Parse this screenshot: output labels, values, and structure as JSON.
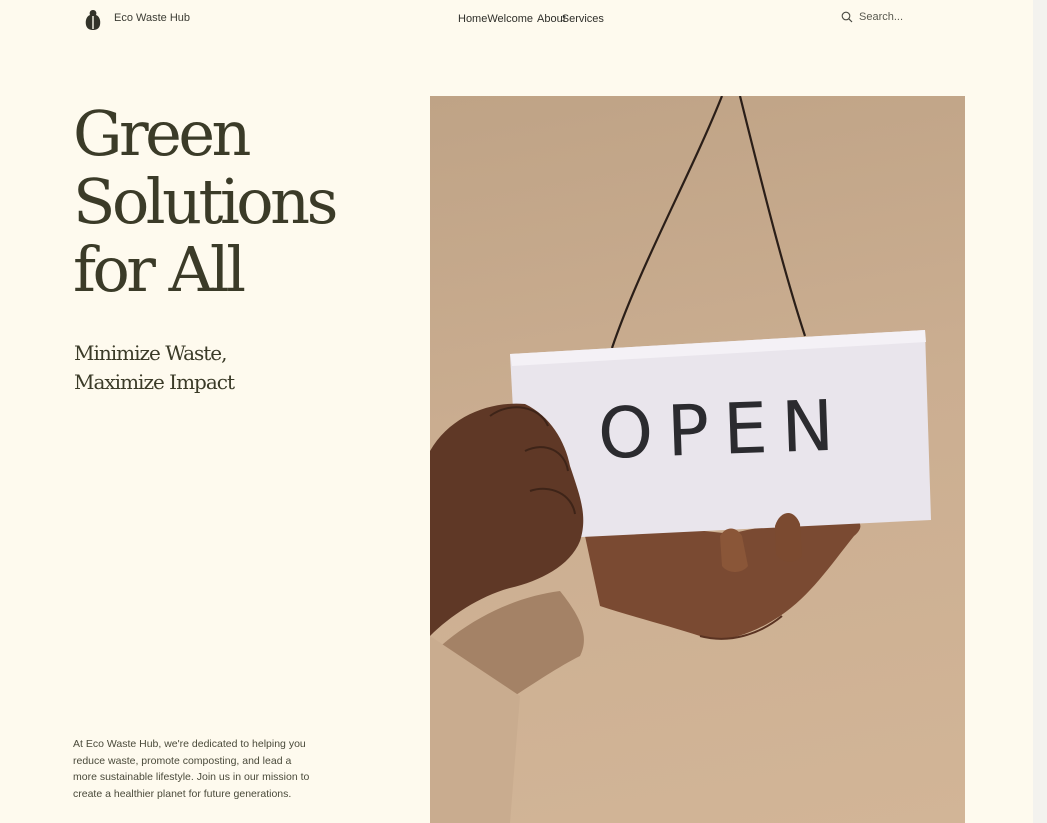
{
  "header": {
    "brand": "Eco Waste Hub",
    "nav": [
      "Home",
      "Welcome",
      "About",
      "Services"
    ],
    "search_placeholder": "Search..."
  },
  "hero": {
    "title_lines": [
      "Green",
      "Solutions",
      "for All"
    ],
    "subtitle_lines": [
      "Minimize Waste,",
      "Maximize Impact"
    ],
    "description": "At Eco Waste Hub, we're dedicated to helping you reduce waste, promote composting, and lead a more sustainable lifestyle. Join us in our mission to create a healthier planet for future generations."
  },
  "image": {
    "sign_text": "OPEN"
  },
  "icons": {
    "logo": "leaf-logo-icon",
    "search": "search-icon"
  }
}
